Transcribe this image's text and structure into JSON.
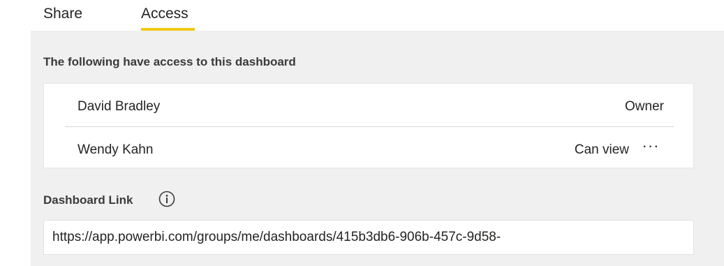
{
  "tabs": [
    {
      "label": "Share",
      "active": false
    },
    {
      "label": "Access",
      "active": true
    }
  ],
  "accent_color": "#f2c811",
  "access": {
    "title": "The following have access to this dashboard",
    "people": [
      {
        "name": "David Bradley",
        "role": "Owner"
      },
      {
        "name": "Wendy Kahn",
        "role": "Can view",
        "more": "···"
      }
    ]
  },
  "link": {
    "label": "Dashboard Link",
    "icon": "info-icon",
    "value": "https://app.powerbi.com/groups/me/dashboards/415b3db6-906b-457c-9d58-"
  }
}
